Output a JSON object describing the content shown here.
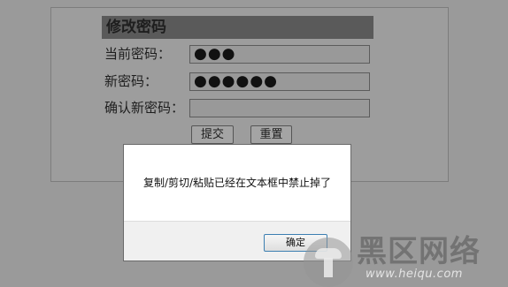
{
  "form": {
    "title": "修改密码",
    "current_label": "当前密码：",
    "current_value": "●●●",
    "new_label": "新密码：",
    "new_value": "●●●●●●",
    "confirm_label": "确认新密码：",
    "confirm_value": "",
    "submit_label": "提交",
    "reset_label": "重置"
  },
  "dialog": {
    "message": "复制/剪切/粘贴已经在文本框中禁止掉了",
    "ok_label": "确定"
  },
  "watermark": {
    "text": "黑区网络",
    "url": "www.heiqu.com"
  },
  "colors": {
    "overlay_bg": "#9a9a9a",
    "title_bar": "#5a5a5a",
    "dialog_bg": "#ffffff",
    "ok_border": "#3c7fb1"
  }
}
